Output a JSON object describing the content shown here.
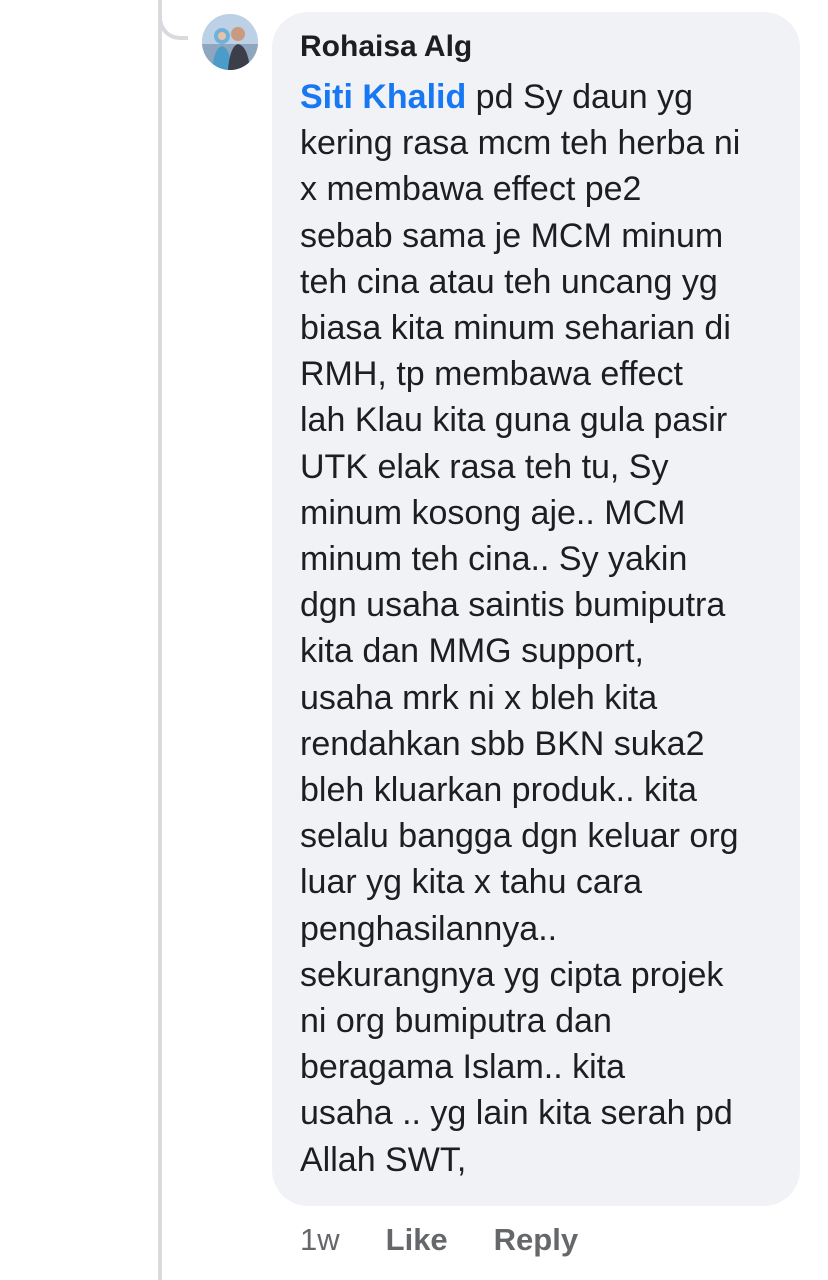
{
  "comment": {
    "author": "Rohaisa Alg",
    "mention": "Siti Khalid",
    "lines": [
      " pd Sy daun yg",
      "kering rasa mcm teh herba ni",
      "x membawa effect pe2",
      "sebab sama je MCM minum",
      "teh cina atau teh uncang yg",
      "biasa kita minum seharian di",
      "RMH, tp membawa effect",
      "lah Klau kita guna gula pasir",
      "UTK elak rasa teh tu, Sy",
      "minum kosong aje.. MCM",
      "minum teh cina.. Sy yakin",
      "dgn usaha saintis bumiputra",
      "kita dan MMG support,",
      "usaha mrk ni x bleh kita",
      "rendahkan sbb BKN suka2",
      "bleh kluarkan produk.. kita",
      "selalu bangga dgn keluar org",
      "luar yg kita x tahu cara",
      "penghasilannya..",
      "sekurangnya yg cipta projek",
      "ni org bumiputra dan",
      "beragama Islam.. kita",
      "usaha .. yg lain kita serah pd",
      "Allah SWT,"
    ]
  },
  "actions": {
    "time": "1w",
    "like": "Like",
    "reply": "Reply"
  },
  "colors": {
    "bubble": "#f0f2f5",
    "mention": "#1877f2",
    "text": "#1c1e21",
    "meta": "#65676b"
  },
  "icons": {
    "avatar": "profile-photo"
  }
}
